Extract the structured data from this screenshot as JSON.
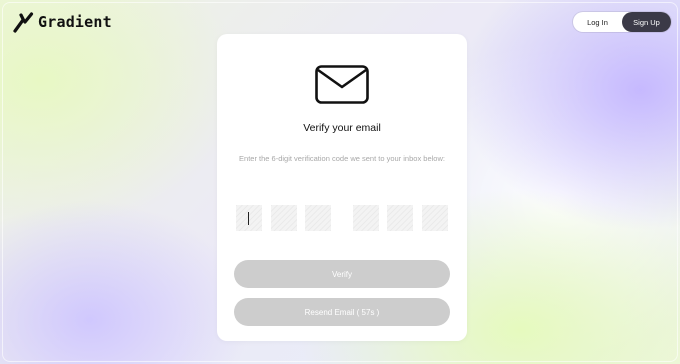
{
  "brand": {
    "name": "Gradient",
    "logo_icon": "gradient-logo-icon"
  },
  "header": {
    "login_label": "Log In",
    "signup_label": "Sign Up",
    "active": "signup"
  },
  "verify": {
    "icon": "mail-icon",
    "title": "Verify your email",
    "subtitle": "Enter the 6-digit verification code we sent to your inbox below:",
    "digits": [
      "",
      "",
      "",
      "",
      "",
      ""
    ],
    "verify_label": "Verify",
    "resend_label": "Resend Email ( 57s )"
  },
  "colors": {
    "accent_dark": "#3b3a47",
    "button_disabled": "#cdcdcd",
    "digit_box": "#f3f3f3",
    "subtitle_text": "#a8a8a8"
  }
}
